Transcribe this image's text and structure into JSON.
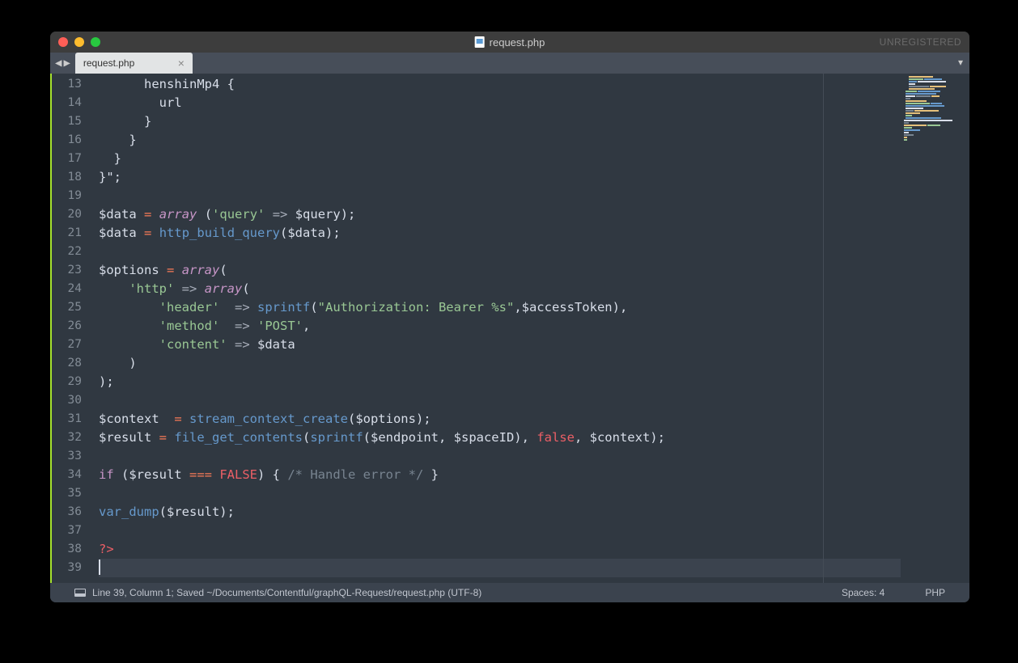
{
  "window": {
    "title": "request.php",
    "registration": "UNREGISTERED"
  },
  "tabs": {
    "active": "request.php"
  },
  "gutter": {
    "start": 13,
    "end": 39
  },
  "code": {
    "lines": [
      [
        {
          "t": "      henshinMp4 {",
          "c": "c-default"
        }
      ],
      [
        {
          "t": "        url",
          "c": "c-default"
        }
      ],
      [
        {
          "t": "      }",
          "c": "c-default"
        }
      ],
      [
        {
          "t": "    }",
          "c": "c-default"
        }
      ],
      [
        {
          "t": "  }",
          "c": "c-default"
        }
      ],
      [
        {
          "t": "}\"",
          "c": "c-default"
        },
        {
          "t": ";",
          "c": "c-punc"
        }
      ],
      [],
      [
        {
          "t": "$data",
          "c": "c-var"
        },
        {
          "t": " ",
          "c": "c-default"
        },
        {
          "t": "=",
          "c": "c-operator"
        },
        {
          "t": " ",
          "c": "c-default"
        },
        {
          "t": "array",
          "c": "c-keyword"
        },
        {
          "t": " (",
          "c": "c-punc"
        },
        {
          "t": "'query'",
          "c": "c-string"
        },
        {
          "t": " ",
          "c": "c-default"
        },
        {
          "t": "=>",
          "c": "c-arrow"
        },
        {
          "t": " $query);",
          "c": "c-default"
        }
      ],
      [
        {
          "t": "$data",
          "c": "c-var"
        },
        {
          "t": " ",
          "c": "c-default"
        },
        {
          "t": "=",
          "c": "c-operator"
        },
        {
          "t": " ",
          "c": "c-default"
        },
        {
          "t": "http_build_query",
          "c": "c-func"
        },
        {
          "t": "($data);",
          "c": "c-default"
        }
      ],
      [],
      [
        {
          "t": "$options",
          "c": "c-var"
        },
        {
          "t": " ",
          "c": "c-default"
        },
        {
          "t": "=",
          "c": "c-operator"
        },
        {
          "t": " ",
          "c": "c-default"
        },
        {
          "t": "array",
          "c": "c-keyword"
        },
        {
          "t": "(",
          "c": "c-punc"
        }
      ],
      [
        {
          "t": "    ",
          "c": "c-default"
        },
        {
          "t": "'http'",
          "c": "c-string"
        },
        {
          "t": " ",
          "c": "c-default"
        },
        {
          "t": "=>",
          "c": "c-arrow"
        },
        {
          "t": " ",
          "c": "c-default"
        },
        {
          "t": "array",
          "c": "c-keyword"
        },
        {
          "t": "(",
          "c": "c-punc"
        }
      ],
      [
        {
          "t": "        ",
          "c": "c-default"
        },
        {
          "t": "'header'",
          "c": "c-string"
        },
        {
          "t": "  ",
          "c": "c-default"
        },
        {
          "t": "=>",
          "c": "c-arrow"
        },
        {
          "t": " ",
          "c": "c-default"
        },
        {
          "t": "sprintf",
          "c": "c-func"
        },
        {
          "t": "(",
          "c": "c-punc"
        },
        {
          "t": "\"Authorization: Bearer %s\"",
          "c": "c-string"
        },
        {
          "t": ",$accessToken),",
          "c": "c-default"
        }
      ],
      [
        {
          "t": "        ",
          "c": "c-default"
        },
        {
          "t": "'method'",
          "c": "c-string"
        },
        {
          "t": "  ",
          "c": "c-default"
        },
        {
          "t": "=>",
          "c": "c-arrow"
        },
        {
          "t": " ",
          "c": "c-default"
        },
        {
          "t": "'POST'",
          "c": "c-string"
        },
        {
          "t": ",",
          "c": "c-punc"
        }
      ],
      [
        {
          "t": "        ",
          "c": "c-default"
        },
        {
          "t": "'content'",
          "c": "c-string"
        },
        {
          "t": " ",
          "c": "c-default"
        },
        {
          "t": "=>",
          "c": "c-arrow"
        },
        {
          "t": " $data",
          "c": "c-default"
        }
      ],
      [
        {
          "t": "    )",
          "c": "c-punc"
        }
      ],
      [
        {
          "t": ");",
          "c": "c-punc"
        }
      ],
      [],
      [
        {
          "t": "$context",
          "c": "c-var"
        },
        {
          "t": "  ",
          "c": "c-default"
        },
        {
          "t": "=",
          "c": "c-operator"
        },
        {
          "t": " ",
          "c": "c-default"
        },
        {
          "t": "stream_context_create",
          "c": "c-func"
        },
        {
          "t": "($options);",
          "c": "c-default"
        }
      ],
      [
        {
          "t": "$result",
          "c": "c-var"
        },
        {
          "t": " ",
          "c": "c-default"
        },
        {
          "t": "=",
          "c": "c-operator"
        },
        {
          "t": " ",
          "c": "c-default"
        },
        {
          "t": "file_get_contents",
          "c": "c-func"
        },
        {
          "t": "(",
          "c": "c-punc"
        },
        {
          "t": "sprintf",
          "c": "c-func"
        },
        {
          "t": "($endpoint, $spaceID), ",
          "c": "c-default"
        },
        {
          "t": "false",
          "c": "c-const"
        },
        {
          "t": ", $context);",
          "c": "c-default"
        }
      ],
      [],
      [
        {
          "t": "if",
          "c": "c-keyword-nf"
        },
        {
          "t": " ($result ",
          "c": "c-default"
        },
        {
          "t": "===",
          "c": "c-operator"
        },
        {
          "t": " ",
          "c": "c-default"
        },
        {
          "t": "FALSE",
          "c": "c-const"
        },
        {
          "t": ") { ",
          "c": "c-default"
        },
        {
          "t": "/* Handle error */",
          "c": "c-comment"
        },
        {
          "t": " }",
          "c": "c-default"
        }
      ],
      [],
      [
        {
          "t": "var_dump",
          "c": "c-func"
        },
        {
          "t": "($result);",
          "c": "c-default"
        }
      ],
      [],
      [
        {
          "t": "?>",
          "c": "c-tag"
        }
      ],
      []
    ],
    "cursor_line_index": 26
  },
  "statusbar": {
    "left": "Line 39, Column 1; Saved ~/Documents/Contentful/graphQL-Request/request.php (UTF-8)",
    "spaces": "Spaces: 4",
    "language": "PHP"
  }
}
